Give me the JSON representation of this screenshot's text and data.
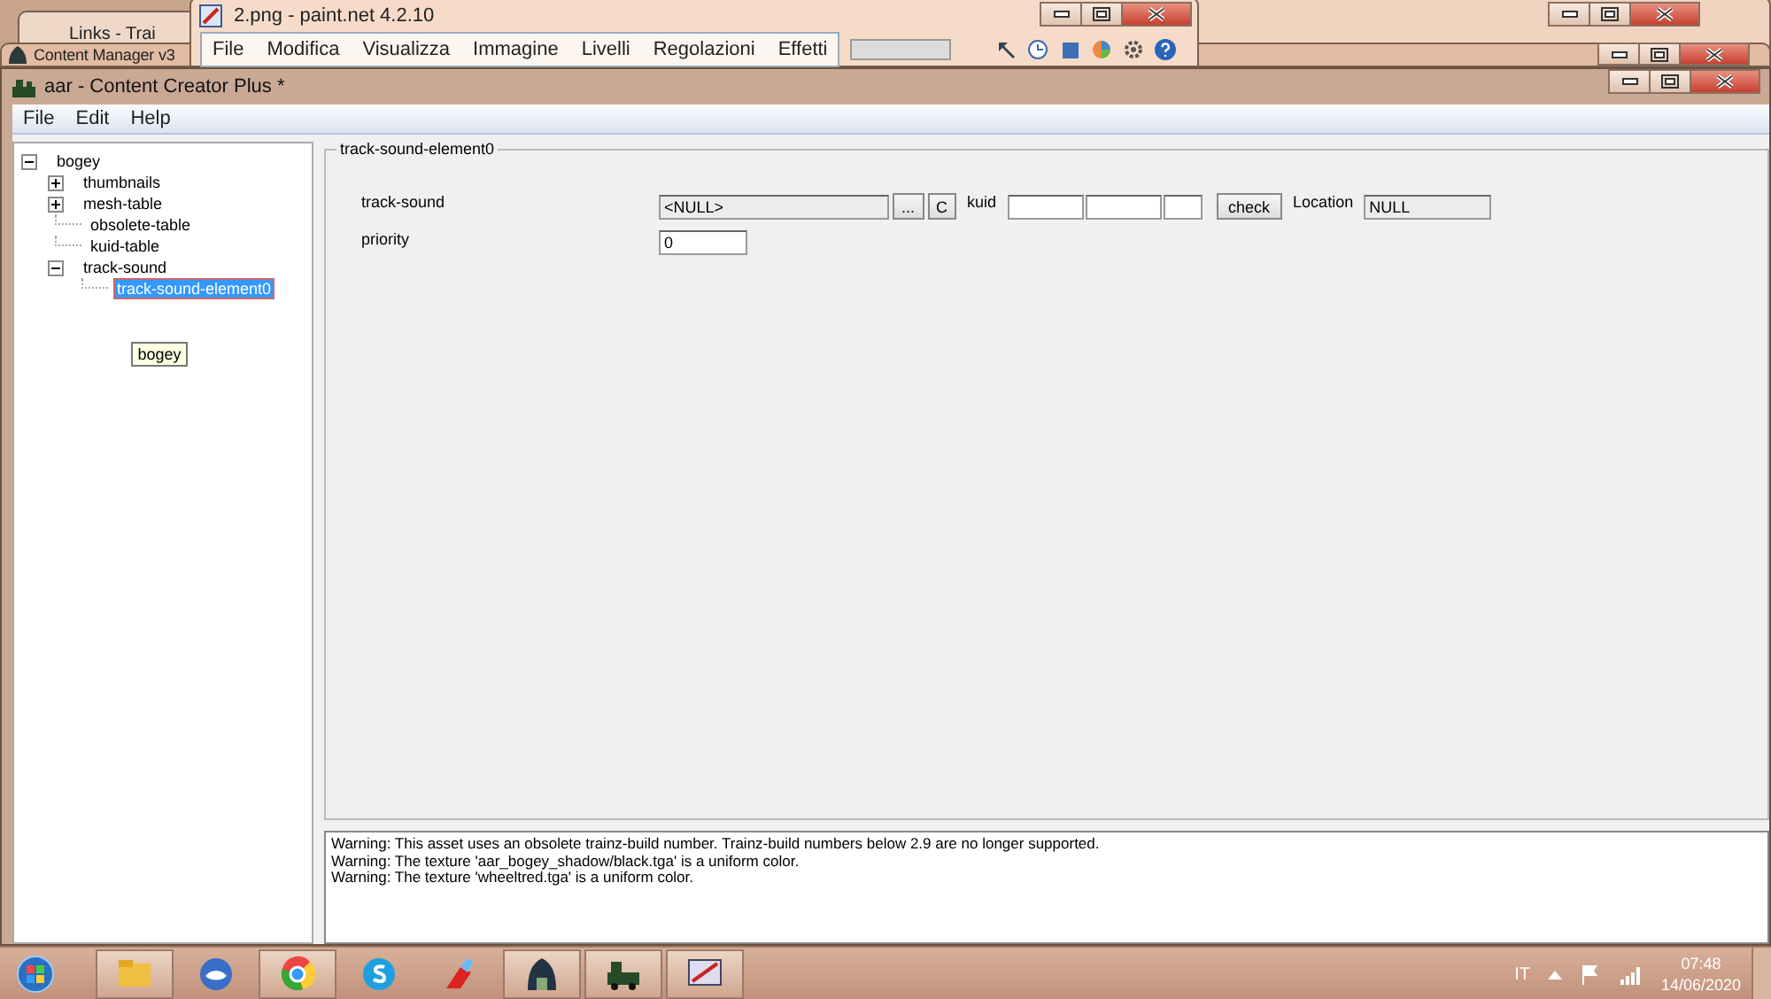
{
  "desktop_windows": [
    {
      "title": "Links - Trai"
    },
    {
      "title": "Content Manager v3"
    },
    {
      "title": "2.png - paint.net 4.2.10",
      "menu": [
        "File",
        "Modifica",
        "Visualizza",
        "Immagine",
        "Livelli",
        "Regolazioni",
        "Effetti"
      ]
    }
  ],
  "window": {
    "title": "aar - Content Creator Plus *"
  },
  "menu": [
    "File",
    "Edit",
    "Help"
  ],
  "tree": [
    {
      "label": "bogey",
      "expanded": true,
      "selected": false,
      "children": [
        {
          "label": "thumbnails",
          "expanded": false,
          "selected": false
        },
        {
          "label": "mesh-table",
          "expanded": false,
          "selected": false
        },
        {
          "label": "obsolete-table",
          "selected": false
        },
        {
          "label": "kuid-table",
          "selected": false
        },
        {
          "label": "track-sound",
          "expanded": true,
          "selected": false,
          "children": [
            {
              "label": "track-sound-element0",
              "selected": true
            }
          ]
        }
      ]
    }
  ],
  "tooltip": "bogey",
  "group": {
    "title": "track-sound-element0",
    "rows": [
      {
        "label": "track-sound",
        "value": "<NULL>",
        "browse": "...",
        "clear": "C",
        "kuid_label": "kuid",
        "kuid_fields": [
          {
            "kind": "number"
          },
          {
            "kind": "number"
          },
          {
            "kind": "revision"
          }
        ],
        "check": "check",
        "location_label": "Location",
        "location": "NULL"
      },
      {
        "label": "priority",
        "value": "0"
      }
    ]
  },
  "log": [
    "Warning: This asset uses an obsolete trainz-build number. Trainz-build numbers below 2.9 are no longer supported.",
    "Warning: The texture 'aar_bogey_shadow/black.tga' is a uniform color.",
    "Warning: The texture 'wheeltred.tga' is a uniform color."
  ],
  "taskbar": {
    "language": "IT",
    "time": "07:48",
    "date": "14/06/2020"
  }
}
